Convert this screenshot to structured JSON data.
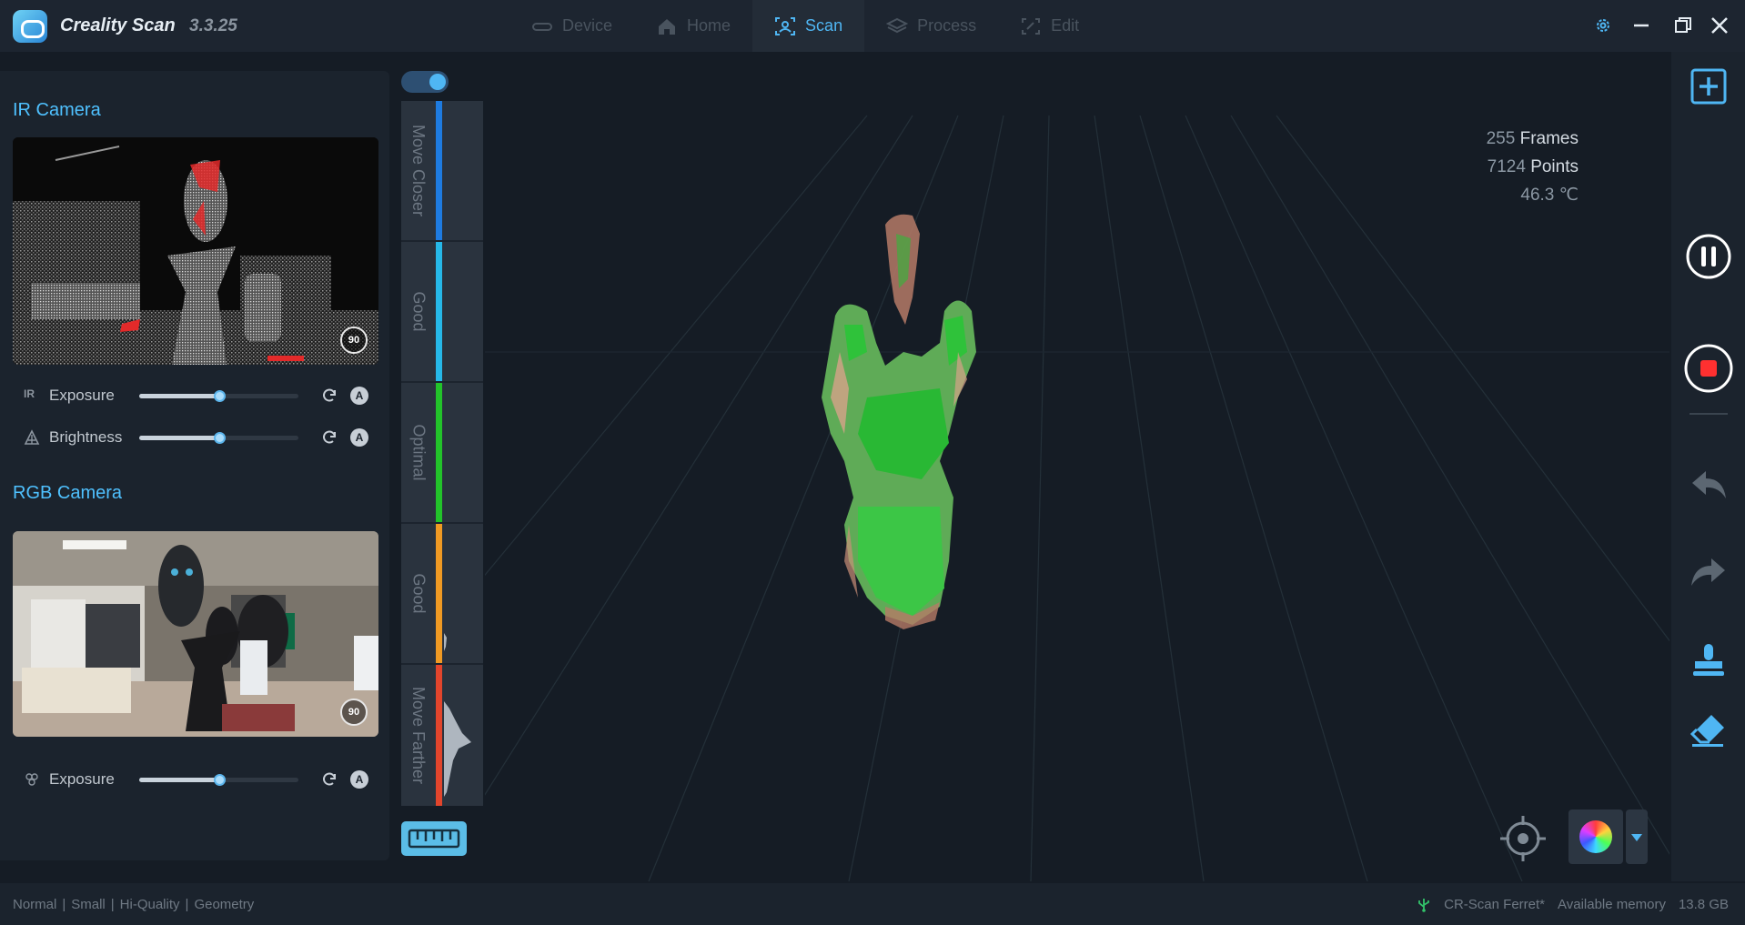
{
  "app": {
    "title": "Creality Scan",
    "version": "3.3.25"
  },
  "nav": {
    "tabs": [
      {
        "label": "Device",
        "active": false
      },
      {
        "label": "Home",
        "active": false
      },
      {
        "label": "Scan",
        "active": true
      },
      {
        "label": "Process",
        "active": false
      },
      {
        "label": "Edit",
        "active": false
      }
    ]
  },
  "left_panel": {
    "ir_camera": {
      "title": "IR Camera",
      "rotate_badge": "90",
      "exposure": {
        "icon_text": "IR",
        "label": "Exposure",
        "value": 0.5,
        "auto": "A"
      },
      "brightness": {
        "label": "Brightness",
        "value": 0.5,
        "auto": "A"
      }
    },
    "rgb_camera": {
      "title": "RGB Camera",
      "rotate_badge": "90",
      "exposure": {
        "label": "Exposure",
        "value": 0.5,
        "auto": "A"
      }
    }
  },
  "distance_meter": {
    "enabled": true,
    "segments": [
      {
        "label": "Move Closer",
        "color": "#1e7be0"
      },
      {
        "label": "Good",
        "color": "#26b8e8"
      },
      {
        "label": "Optimal",
        "color": "#22c32a"
      },
      {
        "label": "Good",
        "color": "#f09a23"
      },
      {
        "label": "Move Farther",
        "color": "#e2452c"
      }
    ]
  },
  "stats": {
    "frames_value": "255",
    "frames_label": "Frames",
    "points_value": "7124",
    "points_label": "Points",
    "temperature": "46.3 ℃"
  },
  "status_bar": {
    "modes": [
      "Normal",
      "Small",
      "Hi-Quality",
      "Geometry"
    ],
    "device": "CR-Scan Ferret*",
    "memory_label": "Available memory",
    "memory_value": "13.8 GB"
  },
  "colors": {
    "accent": "#4fb6f3",
    "record_red": "#ff3030",
    "background": "#151c25"
  }
}
